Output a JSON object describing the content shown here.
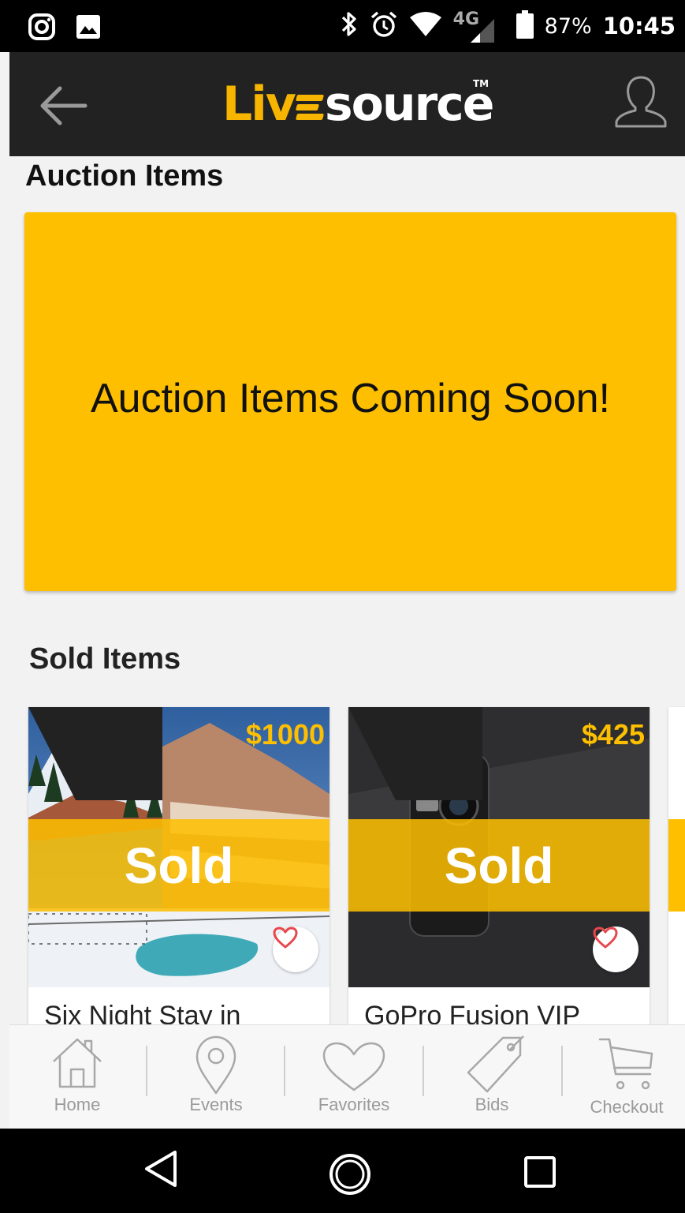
{
  "status_bar": {
    "battery_percent": "87%",
    "time": "10:45",
    "network": "4G",
    "icons": [
      "instagram-icon",
      "gallery-icon",
      "bluetooth-icon",
      "alarm-icon",
      "wifi-icon",
      "signal-icon",
      "battery-icon"
    ]
  },
  "header": {
    "logo_live": "Liv",
    "logo_source": "source",
    "logo_tm": "TM",
    "icons": [
      "back-arrow-icon",
      "profile-icon"
    ]
  },
  "auction": {
    "title": "Auction Items",
    "banner_text": "Auction Items Coming Soon!"
  },
  "sold": {
    "title": "Sold Items",
    "items": [
      {
        "price": "$1000",
        "status": "Sold",
        "title": "Six Night Stay in"
      },
      {
        "price": "$425",
        "status": "Sold",
        "title": "GoPro Fusion VIP"
      }
    ]
  },
  "bottom_nav": {
    "items": [
      {
        "label": "Home",
        "icon": "home-icon"
      },
      {
        "label": "Events",
        "icon": "map-pin-icon"
      },
      {
        "label": "Favorites",
        "icon": "heart-icon"
      },
      {
        "label": "Bids",
        "icon": "tag-icon"
      },
      {
        "label": "Checkout",
        "icon": "cart-icon"
      }
    ]
  },
  "colors": {
    "accent": "#fdbf00",
    "header_bg": "#222222",
    "background": "#f2f2f2",
    "heart": "#e8474c"
  }
}
